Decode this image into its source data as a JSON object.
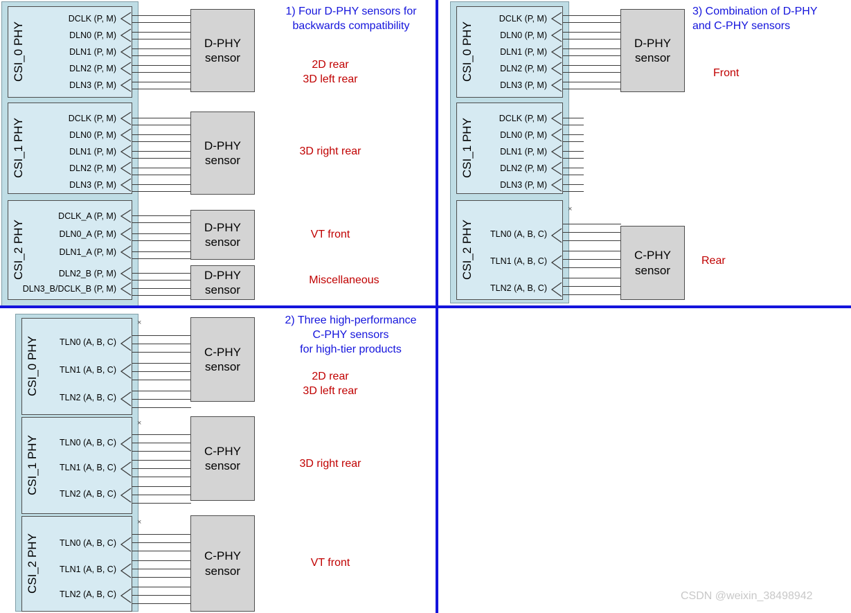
{
  "colors": {
    "divider": "#1414dc",
    "note_blue": "#1414dc",
    "note_red": "#c00000",
    "phy_fill": "#d6eaf2",
    "phy_group_fill": "#bfdde5",
    "sensor_fill": "#d4d4d4",
    "watermark": "#c8c8c8"
  },
  "labels": {
    "dphy_sensor_line1": "D-PHY",
    "dphy_sensor_line2": "sensor",
    "cphy_sensor_line1": "C-PHY",
    "cphy_sensor_line2": "sensor",
    "x_marker": "×"
  },
  "quadrants": {
    "top_left": {
      "heading": "1) Four D-PHY sensors for\n      backwards compatibility",
      "phys": [
        {
          "title": "CSI_0 PHY",
          "ports": [
            "DCLK (P, M)",
            "DLN0 (P, M)",
            "DLN1 (P, M)",
            "DLN2 (P, M)",
            "DLN3 (P, M)"
          ]
        },
        {
          "title": "CSI_1 PHY",
          "ports": [
            "DCLK (P, M)",
            "DLN0 (P, M)",
            "DLN1 (P, M)",
            "DLN2 (P, M)",
            "DLN3 (P, M)"
          ]
        },
        {
          "title": "CSI_2 PHY",
          "ports": [
            "DCLK_A (P, M)",
            "DLN0_A (P, M)",
            "DLN1_A (P, M)",
            "DLN2_B (P, M)",
            "DLN3_B/DCLK_B (P, M)"
          ]
        }
      ],
      "sensors": [
        {
          "type": "D-PHY",
          "caption": "2D rear\n3D left rear"
        },
        {
          "type": "D-PHY",
          "caption": "3D right rear"
        },
        {
          "type": "D-PHY",
          "caption": "VT front"
        },
        {
          "type": "D-PHY",
          "caption": "Miscellaneous"
        }
      ]
    },
    "bottom_left": {
      "heading": "2) Three high-performance\n     C-PHY sensors\n     for high-tier products",
      "phys": [
        {
          "title": "CSI_0 PHY",
          "ports": [
            "TLN0 (A, B, C)",
            "TLN1 (A, B, C)",
            "TLN2 (A, B, C)"
          ]
        },
        {
          "title": "CSI_1 PHY",
          "ports": [
            "TLN0 (A, B, C)",
            "TLN1 (A, B, C)",
            "TLN2 (A, B, C)"
          ]
        },
        {
          "title": "CSI_2 PHY",
          "ports": [
            "TLN0 (A, B, C)",
            "TLN1 (A, B, C)",
            "TLN2 (A, B, C)"
          ]
        }
      ],
      "sensors": [
        {
          "type": "C-PHY",
          "caption": "2D rear\n3D left rear"
        },
        {
          "type": "C-PHY",
          "caption": "3D right rear"
        },
        {
          "type": "C-PHY",
          "caption": "VT front"
        }
      ]
    },
    "right": {
      "heading": "3) Combination of D-PHY\nand C-PHY sensors",
      "phys": [
        {
          "title": "CSI_0 PHY",
          "ports": [
            "DCLK (P, M)",
            "DLN0 (P, M)",
            "DLN1 (P, M)",
            "DLN2 (P, M)",
            "DLN3 (P, M)"
          ]
        },
        {
          "title": "CSI_1 PHY",
          "ports": [
            "DCLK (P, M)",
            "DLN0 (P, M)",
            "DLN1 (P, M)",
            "DLN2 (P, M)",
            "DLN3 (P, M)"
          ]
        },
        {
          "title": "CSI_2 PHY",
          "ports": [
            "TLN0 (A, B, C)",
            "TLN1 (A, B, C)",
            "TLN2 (A, B, C)"
          ]
        }
      ],
      "sensors": [
        {
          "type": "D-PHY",
          "caption": "Front"
        },
        {
          "type": "C-PHY",
          "caption": "Rear"
        }
      ]
    }
  },
  "watermark": "CSDN @weixin_38498942"
}
